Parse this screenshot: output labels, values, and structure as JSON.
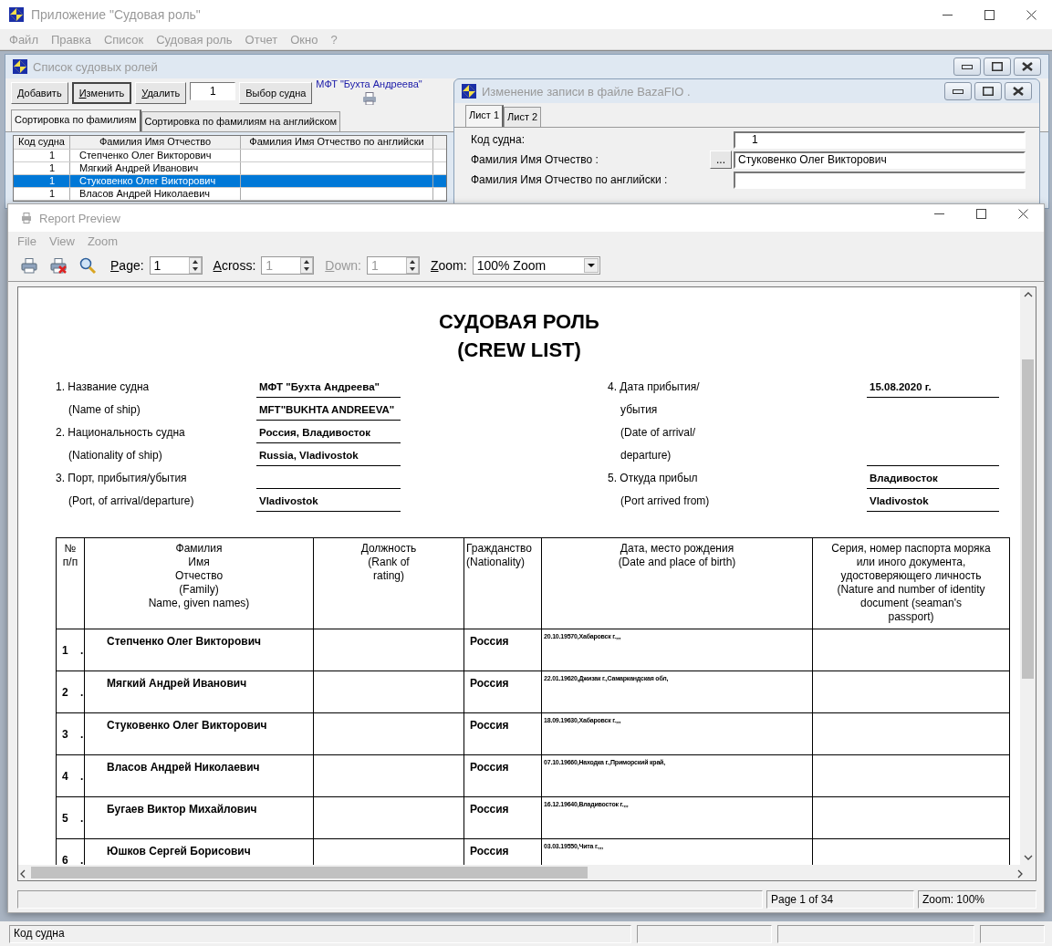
{
  "app": {
    "title": "Приложение \"Судовая роль\"",
    "menu": [
      "Файл",
      "Правка",
      "Список",
      "Судовая роль",
      "Отчет",
      "Окно",
      "?"
    ]
  },
  "list_window": {
    "title": "Список судовых ролей",
    "buttons": [
      {
        "label": "Добавить",
        "selected": false
      },
      {
        "label": "Изменить",
        "selected": true
      },
      {
        "label": "Удалить",
        "selected": false
      }
    ],
    "counter": "1",
    "select_button": "Выбор судна",
    "ship_name": "МФТ \"Бухта Андреева\"",
    "tabs": [
      {
        "label": "Сортировка по фамилиям",
        "selected": true
      },
      {
        "label": "Сортировка по фамилиям на английском",
        "selected": false
      }
    ],
    "columns": [
      "Код судна",
      "Фамилия Имя Отчество",
      "Фамилия Имя Отчество по английски"
    ],
    "rows": [
      {
        "code": "1",
        "name": "Степченко Олег Викторович",
        "selected": false
      },
      {
        "code": "1",
        "name": "Мягкий Андрей Иванович",
        "selected": false
      },
      {
        "code": "1",
        "name": "Стуковенко Олег Викторович",
        "selected": true
      },
      {
        "code": "1",
        "name": "Власов Андрей Николаевич",
        "selected": false
      }
    ]
  },
  "edit_window": {
    "title": "Изменение записи в файле BazaFIO .",
    "tabs": [
      {
        "label": "Лист 1",
        "selected": true
      },
      {
        "label": "Лист 2",
        "selected": false
      }
    ],
    "browse_label": "...",
    "fields": [
      {
        "label": "Код судна:",
        "value": "1",
        "browse": false
      },
      {
        "label": "Фамилия Имя Отчество :",
        "value": "Стуковенко Олег Викторович",
        "browse": true
      },
      {
        "label": "Фамилия Имя Отчество по английски :",
        "browse": false
      }
    ]
  },
  "report_preview": {
    "title": "Report Preview",
    "menu": [
      "File",
      "View",
      "Zoom"
    ],
    "toolbar": [
      {
        "label": "Page:",
        "value": "1",
        "disabled": false
      },
      {
        "label": "Across:",
        "value": "1",
        "disabled": true
      },
      {
        "label": "Down:",
        "value": "1",
        "disabled": true
      }
    ],
    "zoom": {
      "label": "Zoom:",
      "value": "100% Zoom"
    },
    "report": {
      "title": [
        "СУДОВАЯ РОЛЬ",
        "(CREW LIST)"
      ],
      "left_fields": [
        {
          "label": "1. Название судна",
          "value": "МФТ \"Бухта Андреева\"",
          "kind": "main",
          "line": true
        },
        {
          "label": "(Name of ship)",
          "value": "MFT\"BUKHTA ANDREEVA\"",
          "kind": "sub",
          "line": true
        },
        {
          "label": "2. Национальность судна",
          "value": "Россия, Владивосток",
          "kind": "main",
          "line": true
        },
        {
          "label": "(Nationality of ship)",
          "value": "Russia, Vladivostok",
          "kind": "sub",
          "line": true
        },
        {
          "label": "3. Порт, прибытия/убытия",
          "kind": "main",
          "line": true
        },
        {
          "label": "(Port, of arrival/departure)",
          "value": "Vladivostok",
          "kind": "sub",
          "line": true
        }
      ],
      "right_fields": [
        {
          "label": "4. Дата прибытия/",
          "value": "15.08.2020  г.",
          "kind": "main",
          "line": true
        },
        {
          "label": "убытия",
          "kind": "cont",
          "line": false
        },
        {
          "label": "(Date of arrival/",
          "kind": "cont",
          "line": false
        },
        {
          "label": "departure)",
          "kind": "cont",
          "line": true
        },
        {
          "label": "5. Откуда прибыл",
          "value": "Владивосток",
          "kind": "main",
          "line": true
        },
        {
          "label": "(Port arrived from)",
          "value": "Vladivostok",
          "kind": "sub",
          "line": true
        }
      ],
      "columns": [
        "№\nп/п",
        "Фамилия\nИмя\nОтчество\n(Family)\nName, given names)",
        "Должность\n(Rank of\nrating)",
        "Гражданство\n(Nationality)",
        "Дата, место рождения\n(Date and place of birth)",
        "Серия, номер паспорта моряка\nили иного документа,\nудостоверяющего личность\n(Nature and number of identity\ndocument (seaman's\npassport)"
      ],
      "rows": [
        {
          "number": "1    .",
          "name": "Степченко Олег Викторович",
          "nationality": "Россия",
          "birth": "20.10.19570,Хабаровск г.,,,"
        },
        {
          "number": "2    .",
          "name": "Мягкий Андрей Иванович",
          "nationality": "Россия",
          "birth": "22.01.19620,Джизак г.,Самаркандская обл,"
        },
        {
          "number": "3    .",
          "name": "Стуковенко Олег Викторович",
          "nationality": "Россия",
          "birth": "18.09.19630,Хабаровск г.,,,"
        },
        {
          "number": "4    .",
          "name": "Власов Андрей Николаевич",
          "nationality": "Россия",
          "birth": "07.10.19660,Находка г.,Приморский край,"
        },
        {
          "number": "5    .",
          "name": "Бугаев Виктор Михайлович",
          "nationality": "Россия",
          "birth": "16.12.19640,Владивосток г.,,,"
        },
        {
          "number": "6    .",
          "name": "Юшков Сергей Борисович",
          "nationality": "Россия",
          "birth": "03.03.19550,Чита г.,,,"
        }
      ]
    },
    "status": [
      "Page 1 of 34",
      "Zoom: 100%"
    ]
  },
  "status_bar": {
    "text": "Код судна"
  }
}
